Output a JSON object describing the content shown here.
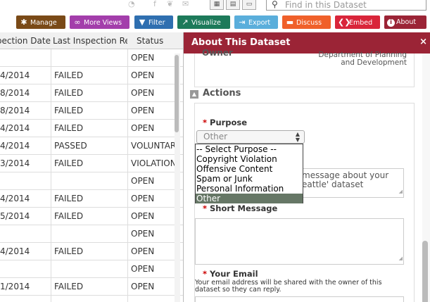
{
  "toolbar": {
    "buttons": [
      {
        "label": "Manage",
        "icon": "gear-icon",
        "glyph": "✱",
        "color": "#7a4a17"
      },
      {
        "label": "More Views",
        "icon": "views-icon",
        "glyph": "∞",
        "color": "#a33eab"
      },
      {
        "label": "Filter",
        "icon": "filter-icon",
        "glyph": "▼",
        "color": "#2f6fb0"
      },
      {
        "label": "Visualize",
        "icon": "chart-icon",
        "glyph": "↗",
        "color": "#1d7a5a"
      },
      {
        "label": "Export",
        "icon": "export-icon",
        "glyph": "⇥",
        "color": "#5aaedb"
      },
      {
        "label": "Discuss",
        "icon": "comment-icon",
        "glyph": "▬",
        "color": "#f0602a"
      },
      {
        "label": "Embed",
        "icon": "embed-icon",
        "glyph": "❮❯",
        "color": "#d9253a"
      },
      {
        "label": "About",
        "icon": "info-icon",
        "glyph": "i",
        "color": "#9b2436"
      }
    ],
    "search_placeholder": "Find in this Dataset",
    "social_icons": [
      "rss-icon",
      "facebook-icon",
      "twitter-icon",
      "email-icon"
    ]
  },
  "grid": {
    "columns": [
      "Inspection Date",
      "Last Inspection Result",
      "Status"
    ],
    "rows": [
      {
        "date": "",
        "result": "",
        "status": "OPEN"
      },
      {
        "date": "4/2014",
        "result": "FAILED",
        "status": "OPEN"
      },
      {
        "date": "8/2014",
        "result": "FAILED",
        "status": "OPEN"
      },
      {
        "date": "8/2014",
        "result": "FAILED",
        "status": "OPEN"
      },
      {
        "date": "4/2014",
        "result": "FAILED",
        "status": "OPEN"
      },
      {
        "date": "4/2014",
        "result": "PASSED",
        "status": "VOLUNTARY"
      },
      {
        "date": "3/2014",
        "result": "FAILED",
        "status": "VIOLATION"
      },
      {
        "date": "",
        "result": "",
        "status": "OPEN"
      },
      {
        "date": "4/2014",
        "result": "FAILED",
        "status": "OPEN"
      },
      {
        "date": "5/2014",
        "result": "FAILED",
        "status": "OPEN"
      },
      {
        "date": "",
        "result": "",
        "status": "OPEN"
      },
      {
        "date": "4/2014",
        "result": "FAILED",
        "status": "OPEN"
      },
      {
        "date": "",
        "result": "",
        "status": "OPEN"
      },
      {
        "date": "1/2014",
        "result": "FAILED",
        "status": "OPEN"
      },
      {
        "date": "",
        "result": "",
        "status": ""
      }
    ]
  },
  "panel": {
    "title": "About This Dataset",
    "close": "×",
    "owner_label": "Owner",
    "owner_value_line1": "Department of Planning",
    "owner_value_line2": "and Development",
    "actions_label": "Actions",
    "purpose_label": "Purpose",
    "purpose_selected": "Other",
    "purpose_options": [
      "-- Select Purpose --",
      "Copyright Violation",
      "Offensive Content",
      "Spam or Junk",
      "Personal Information",
      "Other"
    ],
    "message_partial_line1": "message about your",
    "message_partial_line2": "eattle' dataset",
    "short_message_label": "Short Message",
    "email_label": "Your Email",
    "email_note": "Your email address will be shared with the owner of this dataset so they can reply."
  }
}
